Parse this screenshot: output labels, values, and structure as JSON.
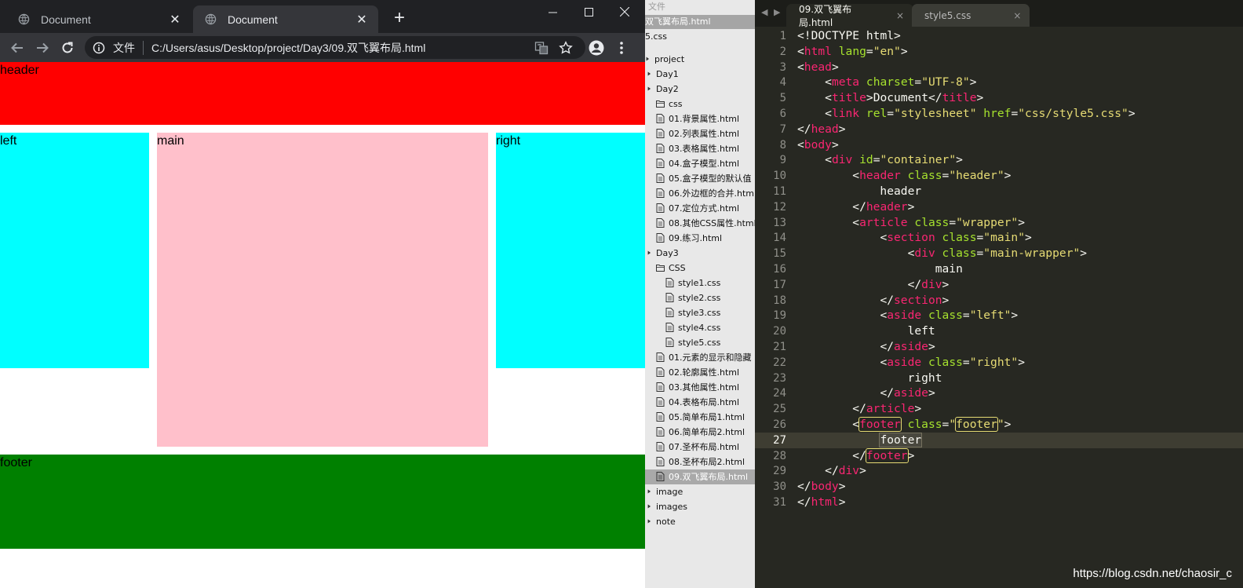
{
  "browser": {
    "tabs": [
      {
        "title": "Document",
        "active": false
      },
      {
        "title": "Document",
        "active": true
      }
    ],
    "new_tab_label": "+",
    "address": {
      "scheme_label": "文件",
      "url": "C:/Users/asus/Desktop/project/Day3/09.双飞翼布局.html"
    },
    "page": {
      "header": "header",
      "left": "left",
      "main": "main",
      "right": "right",
      "footer": "footer"
    },
    "colors": {
      "header": "#ff0000",
      "side": "#00ffff",
      "main": "#ffc0cb",
      "footer": "#008000"
    }
  },
  "sidebar": {
    "top_label": "文件",
    "open_file": "双飞翼布局.html",
    "items": [
      {
        "label": "5.css",
        "depth": 0,
        "icon": "none",
        "selected": false
      },
      {
        "label": "project",
        "depth": 0,
        "icon": "folder",
        "selected": false
      },
      {
        "label": "Day1",
        "depth": 1,
        "icon": "folder",
        "selected": false
      },
      {
        "label": "Day2",
        "depth": 1,
        "icon": "folder",
        "selected": false
      },
      {
        "label": "css",
        "depth": 2,
        "icon": "folder-open",
        "selected": false
      },
      {
        "label": "01.背景属性.html",
        "depth": 2,
        "icon": "file",
        "selected": false
      },
      {
        "label": "02.列表属性.html",
        "depth": 2,
        "icon": "file",
        "selected": false
      },
      {
        "label": "03.表格属性.html",
        "depth": 2,
        "icon": "file",
        "selected": false
      },
      {
        "label": "04.盒子模型.html",
        "depth": 2,
        "icon": "file",
        "selected": false
      },
      {
        "label": "05.盒子模型的默认值",
        "depth": 2,
        "icon": "file",
        "selected": false
      },
      {
        "label": "06.外边框的合并.htm",
        "depth": 2,
        "icon": "file",
        "selected": false
      },
      {
        "label": "07.定位方式.html",
        "depth": 2,
        "icon": "file",
        "selected": false
      },
      {
        "label": "08.其他CSS属性.html",
        "depth": 2,
        "icon": "file",
        "selected": false
      },
      {
        "label": "09.练习.html",
        "depth": 2,
        "icon": "file",
        "selected": false
      },
      {
        "label": "Day3",
        "depth": 1,
        "icon": "folder",
        "selected": false
      },
      {
        "label": "CSS",
        "depth": 2,
        "icon": "folder-open",
        "selected": false
      },
      {
        "label": "style1.css",
        "depth": 3,
        "icon": "file",
        "selected": false
      },
      {
        "label": "style2.css",
        "depth": 3,
        "icon": "file",
        "selected": false
      },
      {
        "label": "style3.css",
        "depth": 3,
        "icon": "file",
        "selected": false
      },
      {
        "label": "style4.css",
        "depth": 3,
        "icon": "file",
        "selected": false
      },
      {
        "label": "style5.css",
        "depth": 3,
        "icon": "file",
        "selected": false
      },
      {
        "label": "01.元素的显示和隐藏",
        "depth": 2,
        "icon": "file",
        "selected": false
      },
      {
        "label": "02.轮廓属性.html",
        "depth": 2,
        "icon": "file",
        "selected": false
      },
      {
        "label": "03.其他属性.html",
        "depth": 2,
        "icon": "file",
        "selected": false
      },
      {
        "label": "04.表格布局.html",
        "depth": 2,
        "icon": "file",
        "selected": false
      },
      {
        "label": "05.简单布局1.html",
        "depth": 2,
        "icon": "file",
        "selected": false
      },
      {
        "label": "06.简单布局2.html",
        "depth": 2,
        "icon": "file",
        "selected": false
      },
      {
        "label": "07.圣杯布局.html",
        "depth": 2,
        "icon": "file",
        "selected": false
      },
      {
        "label": "08.圣杯布局2.html",
        "depth": 2,
        "icon": "file",
        "selected": false
      },
      {
        "label": "09.双飞翼布局.html",
        "depth": 2,
        "icon": "file",
        "selected": true
      },
      {
        "label": "image",
        "depth": 1,
        "icon": "folder",
        "selected": false
      },
      {
        "label": "images",
        "depth": 1,
        "icon": "folder",
        "selected": false
      },
      {
        "label": "note",
        "depth": 1,
        "icon": "folder",
        "selected": false
      }
    ]
  },
  "editor": {
    "tabs": [
      {
        "label": "09.双飞翼布局.html",
        "active": true,
        "close": "×"
      },
      {
        "label": "style5.css",
        "active": false,
        "close": "×"
      }
    ],
    "current_line": 27,
    "lines": [
      "<!DOCTYPE html>",
      "<html lang=\"en\">",
      "<head>",
      "    <meta charset=\"UTF-8\">",
      "    <title>Document</title>",
      "    <link rel=\"stylesheet\" href=\"css/style5.css\">",
      "</head>",
      "<body>",
      "    <div id=\"container\">",
      "        <header class=\"header\">",
      "            header",
      "        </header>",
      "        <article class=\"wrapper\">",
      "            <section class=\"main\">",
      "                <div class=\"main-wrapper\">",
      "                    main",
      "                </div>",
      "            </section>",
      "            <aside class=\"left\">",
      "                left",
      "            </aside>",
      "            <aside class=\"right\">",
      "                right",
      "            </aside>",
      "        </article>",
      "        <footer class=\"footer\">",
      "            footer",
      "        </footer>",
      "    </div>",
      "</body>",
      "</html>"
    ],
    "syntax_colors": {
      "tag": "#f92672",
      "attr": "#a6e22e",
      "string": "#e6db74",
      "text": "#f8f8f2",
      "gutter": "#90908a",
      "background": "#272822"
    }
  },
  "watermark": "https://blog.csdn.net/chaosir_c"
}
